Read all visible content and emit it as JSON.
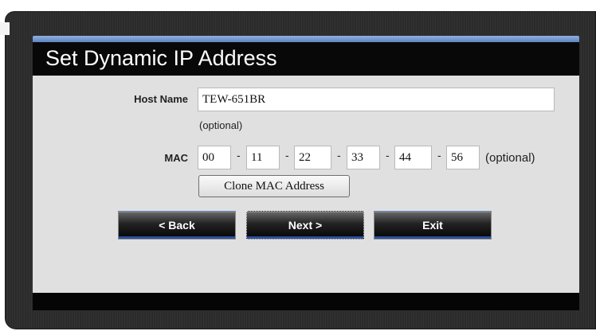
{
  "title": "Set Dynamic IP Address",
  "host": {
    "label": "Host Name",
    "value": "TEW-651BR",
    "hint": "(optional)"
  },
  "mac": {
    "label": "MAC",
    "octets": [
      "00",
      "11",
      "22",
      "33",
      "44",
      "56"
    ],
    "separator": "-",
    "hint": "(optional)"
  },
  "clone_label": "Clone MAC Address",
  "buttons": {
    "back": "< Back",
    "next": "Next >",
    "exit": "Exit"
  }
}
